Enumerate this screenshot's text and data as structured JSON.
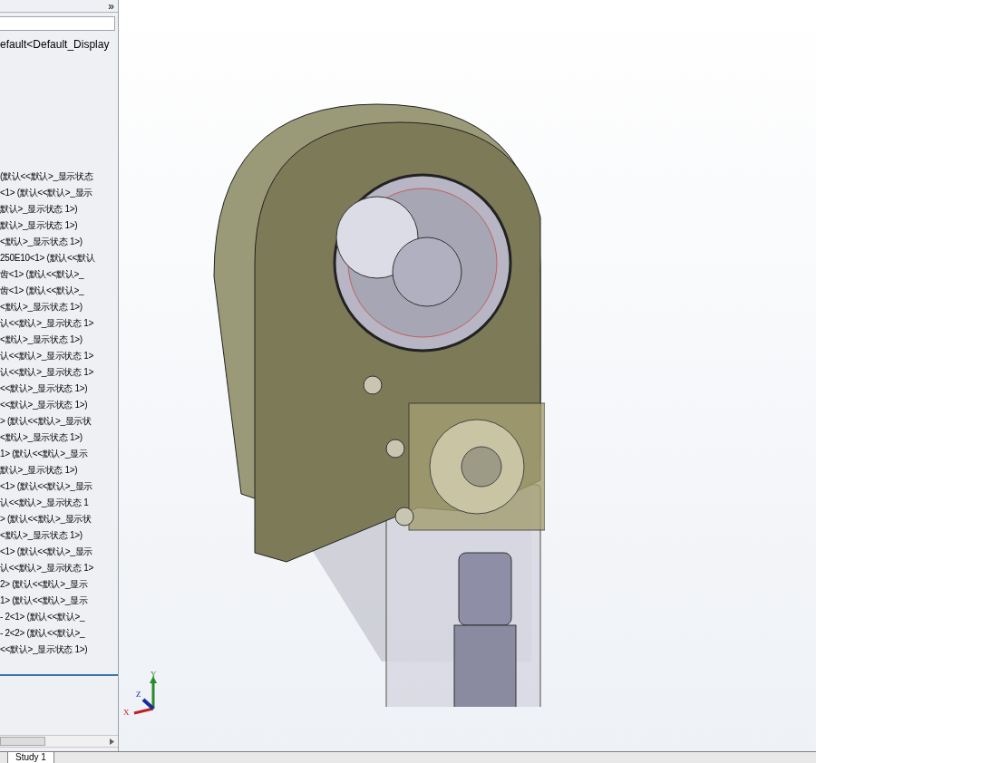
{
  "panel": {
    "collapse_glyph": "»",
    "config_name": "efault<Default_Display",
    "tree_items": [
      "(默认<<默认>_显示状态",
      "<1> (默认<<默认>_显示",
      "默认>_显示状态 1>)",
      "默认>_显示状态 1>)",
      "<默认>_显示状态 1>)",
      "250E10<1> (默认<<默认",
      "齿<1> (默认<<默认>_",
      "齿<1> (默认<<默认>_",
      "<默认>_显示状态 1>)",
      "认<<默认>_显示状态 1>",
      "<默认>_显示状态 1>)",
      "认<<默认>_显示状态 1>",
      "认<<默认>_显示状态 1>",
      "<<默认>_显示状态 1>)",
      "<<默认>_显示状态 1>)",
      "> (默认<<默认>_显示状",
      "<默认>_显示状态 1>)",
      "1> (默认<<默认>_显示",
      "默认>_显示状态 1>)",
      "<1> (默认<<默认>_显示",
      "认<<默认>_显示状态 1",
      "> (默认<<默认>_显示状",
      "<默认>_显示状态 1>)",
      "<1> (默认<<默认>_显示",
      "认<<默认>_显示状态 1>",
      "2> (默认<<默认>_显示",
      "1> (默认<<默认>_显示",
      "- 2<1> (默认<<默认>_",
      "- 2<2> (默认<<默认>_",
      "<<默认>_显示状态 1>)"
    ]
  },
  "triad": {
    "x": "X",
    "y": "Y",
    "z": "Z"
  },
  "bottom_tabs": [
    {
      "label": "Study 1",
      "selected": true
    }
  ]
}
